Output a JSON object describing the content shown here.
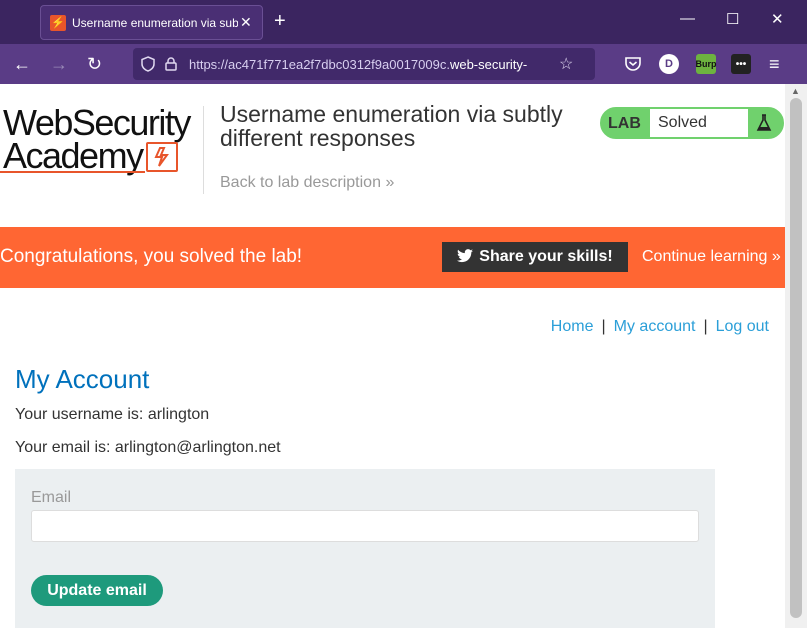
{
  "browser": {
    "tab_title": "Username enumeration via subtl",
    "tab_favicon_glyph": "⚡",
    "new_tab_glyph": "+",
    "url_prefix": "https://ac471f771ea2f7dbc0312f9a0017009c.",
    "url_domain": "web-security-",
    "extension_d_label": "D",
    "extension_burp_label": "Burp"
  },
  "header": {
    "logo_line1": "WebSecurity",
    "logo_line2": "Academy",
    "lab_title": "Username enumeration via subtly different responses",
    "back_link": "Back to lab description",
    "back_arrow": "»",
    "lab_badge_label": "LAB",
    "lab_status": "Solved"
  },
  "banner": {
    "message": "Congratulations, you solved the lab!",
    "share_label": "Share your skills!",
    "continue_label": "Continue learning",
    "continue_arrow": "»"
  },
  "nav": {
    "home": "Home",
    "my_account": "My account",
    "log_out": "Log out",
    "separator": "|"
  },
  "account": {
    "heading": "My Account",
    "username_line": "Your username is: arlington",
    "email_line": "Your email is: arlington@arlington.net",
    "email_label": "Email",
    "email_value": "",
    "update_button": "Update email"
  },
  "colors": {
    "banner": "#ff6633",
    "lab_solved": "#70d16d",
    "heading": "#0071bc",
    "link": "#2b9fd8",
    "button": "#1e9a7c"
  }
}
